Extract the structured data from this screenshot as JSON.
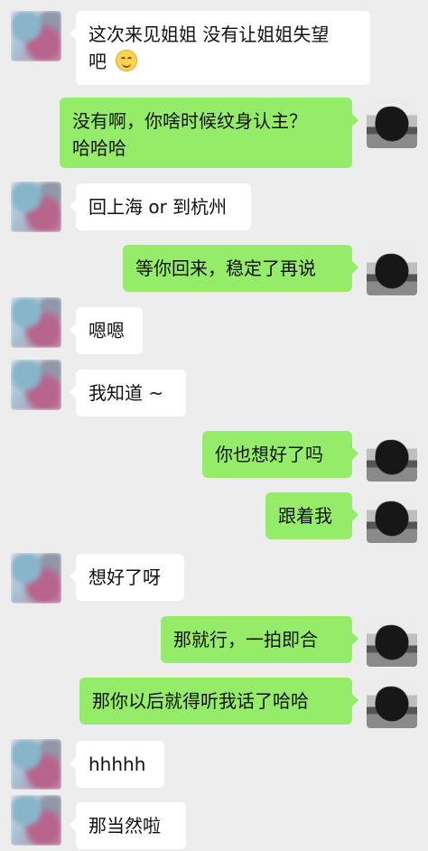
{
  "colors": {
    "background": "#ededed",
    "left_bubble": "#ffffff",
    "right_bubble": "#95ec69",
    "text": "#111111"
  },
  "messages": [
    {
      "side": "left",
      "text_lines": [
        "这次来见姐姐 没有让姐姐失望",
        "吧"
      ],
      "emoji": "slightly-smiling-face-icon"
    },
    {
      "side": "right",
      "text_lines": [
        "没有啊，你啥时候纹身认主？",
        "哈哈哈"
      ]
    },
    {
      "side": "left",
      "text": "回上海 or 到杭州"
    },
    {
      "side": "right",
      "text": "等你回来，稳定了再说"
    },
    {
      "side": "left",
      "text": "嗯嗯"
    },
    {
      "side": "left",
      "text": "我知道 ~"
    },
    {
      "side": "right",
      "text": "你也想好了吗"
    },
    {
      "side": "right",
      "text": "跟着我"
    },
    {
      "side": "left",
      "text": "想好了呀"
    },
    {
      "side": "right",
      "text": "那就行，一拍即合"
    },
    {
      "side": "right",
      "text": "那你以后就得听我话了哈哈"
    },
    {
      "side": "left",
      "text": "hhhhh"
    },
    {
      "side": "left",
      "text": "那当然啦"
    }
  ]
}
